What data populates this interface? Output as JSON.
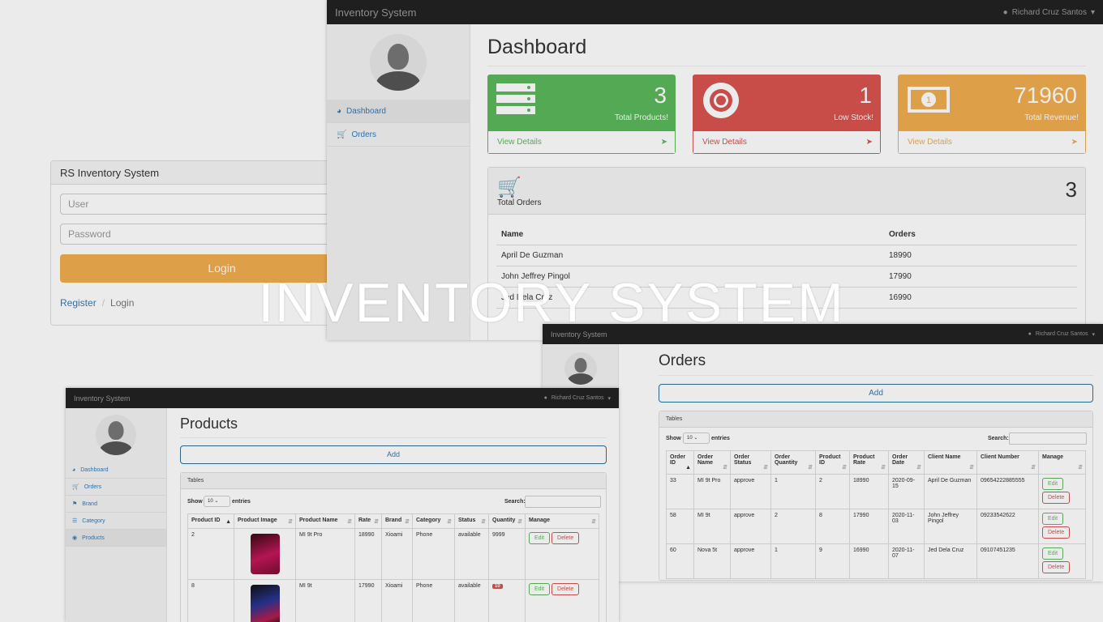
{
  "overlay_title": "INVENTORY SYSTEM",
  "login": {
    "title": "RS Inventory System",
    "user_placeholder": "User",
    "password_placeholder": "Password",
    "login_button": "Login",
    "breadcrumb": [
      "Register",
      "Login"
    ]
  },
  "dashboard": {
    "brand": "Inventory System",
    "user": "Richard Cruz Santos",
    "nav": [
      {
        "label": "Dashboard",
        "icon": "dashboard-icon"
      },
      {
        "label": "Orders",
        "icon": "cart-icon"
      }
    ],
    "title": "Dashboard",
    "cards": [
      {
        "value": "3",
        "label": "Total Products!",
        "footer": "View Details",
        "color": "#5cb85c",
        "icon": "server-icon"
      },
      {
        "value": "1",
        "label": "Low Stock!",
        "footer": "View Details",
        "color": "#d9534f",
        "icon": "lifebuoy-icon"
      },
      {
        "value": "71960",
        "label": "Total Revenue!",
        "footer": "View Details",
        "color": "#f0ad4e",
        "icon": "money-icon"
      }
    ],
    "orders_panel": {
      "label": "Total Orders",
      "count": "3",
      "columns": [
        "Name",
        "Orders"
      ],
      "rows": [
        [
          "April De Guzman",
          "18990"
        ],
        [
          "John Jeffrey Pingol",
          "17990"
        ],
        [
          "Jed Dela Cruz",
          "16990"
        ]
      ]
    }
  },
  "products": {
    "brand": "Inventory System",
    "user": "Richard Cruz Santos",
    "nav": [
      {
        "label": "Dashboard",
        "icon": "dashboard-icon"
      },
      {
        "label": "Orders",
        "icon": "cart-icon"
      },
      {
        "label": "Brand",
        "icon": "bookmark-icon"
      },
      {
        "label": "Category",
        "icon": "list-icon"
      },
      {
        "label": "Products",
        "icon": "products-icon"
      }
    ],
    "title": "Products",
    "add_button": "Add",
    "panel_title": "Tables",
    "show_label": "Show",
    "show_value": "10",
    "entries_label": "entries",
    "search_label": "Search:",
    "columns": [
      "Product ID",
      "Product Image",
      "Product Name",
      "Rate",
      "Brand",
      "Category",
      "Status",
      "Quantity",
      "Manage"
    ],
    "rows": [
      {
        "id": "2",
        "name": "MI 9t Pro",
        "rate": "18990",
        "brand": "Xioami",
        "category": "Phone",
        "status": "available",
        "quantity": "9999",
        "low": false
      },
      {
        "id": "8",
        "name": "MI 9t",
        "rate": "17990",
        "brand": "Xioami",
        "category": "Phone",
        "status": "available",
        "quantity": "10",
        "low": true
      }
    ],
    "edit_label": "Edit",
    "delete_label": "Delete"
  },
  "orders": {
    "brand": "Inventory System",
    "user": "Richard Cruz Santos",
    "title": "Orders",
    "add_button": "Add",
    "panel_title": "Tables",
    "show_label": "Show",
    "show_value": "10",
    "entries_label": "entries",
    "search_label": "Search:",
    "columns": [
      "Order ID",
      "Order Name",
      "Order Status",
      "Order Quantity",
      "Product ID",
      "Product Rate",
      "Order Date",
      "Client Name",
      "Client Number",
      "Manage"
    ],
    "rows": [
      [
        "33",
        "MI 9t Pro",
        "approve",
        "1",
        "2",
        "18990",
        "2020-09-15",
        "April De Guzman",
        "09654222885555"
      ],
      [
        "58",
        "MI 9t",
        "approve",
        "2",
        "8",
        "17990",
        "2020-11-03",
        "John Jeffrey Pingol",
        "09233542622"
      ],
      [
        "60",
        "Nova 5t",
        "approve",
        "1",
        "9",
        "16990",
        "2020-11-07",
        "Jed Dela Cruz",
        "09107451235"
      ]
    ],
    "edit_label": "Edit",
    "delete_label": "Delete"
  }
}
